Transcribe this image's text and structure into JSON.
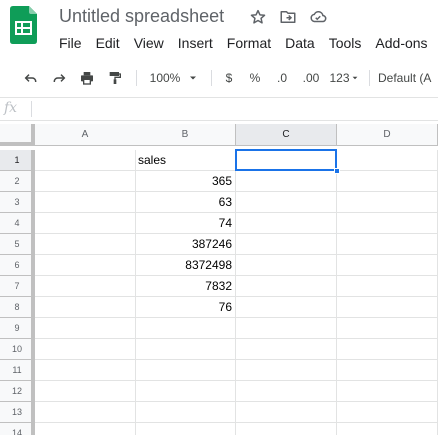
{
  "app": {
    "doc_title": "Untitled spreadsheet",
    "icons": [
      "sheets-logo-icon",
      "star-icon",
      "move-folder-icon",
      "cloud-status-icon"
    ]
  },
  "menu": [
    "File",
    "Edit",
    "View",
    "Insert",
    "Format",
    "Data",
    "Tools",
    "Add-ons"
  ],
  "toolbar": {
    "zoom": "100%",
    "currency": "$",
    "percent": "%",
    "decrease_decimal": ".0",
    "increase_decimal": ".00",
    "more_formats": "123",
    "font": "Default (A"
  },
  "formula_bar": {
    "fx_label": "fx",
    "value": ""
  },
  "sheet": {
    "columns": [
      "A",
      "B",
      "C",
      "D"
    ],
    "rows": [
      "1",
      "2",
      "3",
      "4",
      "5",
      "6",
      "7",
      "8",
      "9",
      "10",
      "11",
      "12",
      "13",
      "14"
    ],
    "selected_cell": "C1",
    "cells": {
      "B1": "sales",
      "B2": "365",
      "B3": "63",
      "B4": "74",
      "B5": "387246",
      "B6": "8372498",
      "B7": "7832",
      "B8": "76"
    }
  },
  "colors": {
    "accent": "#1a73e8",
    "sheets_green": "#0f9d58",
    "header_bg": "#f8f9fa"
  }
}
